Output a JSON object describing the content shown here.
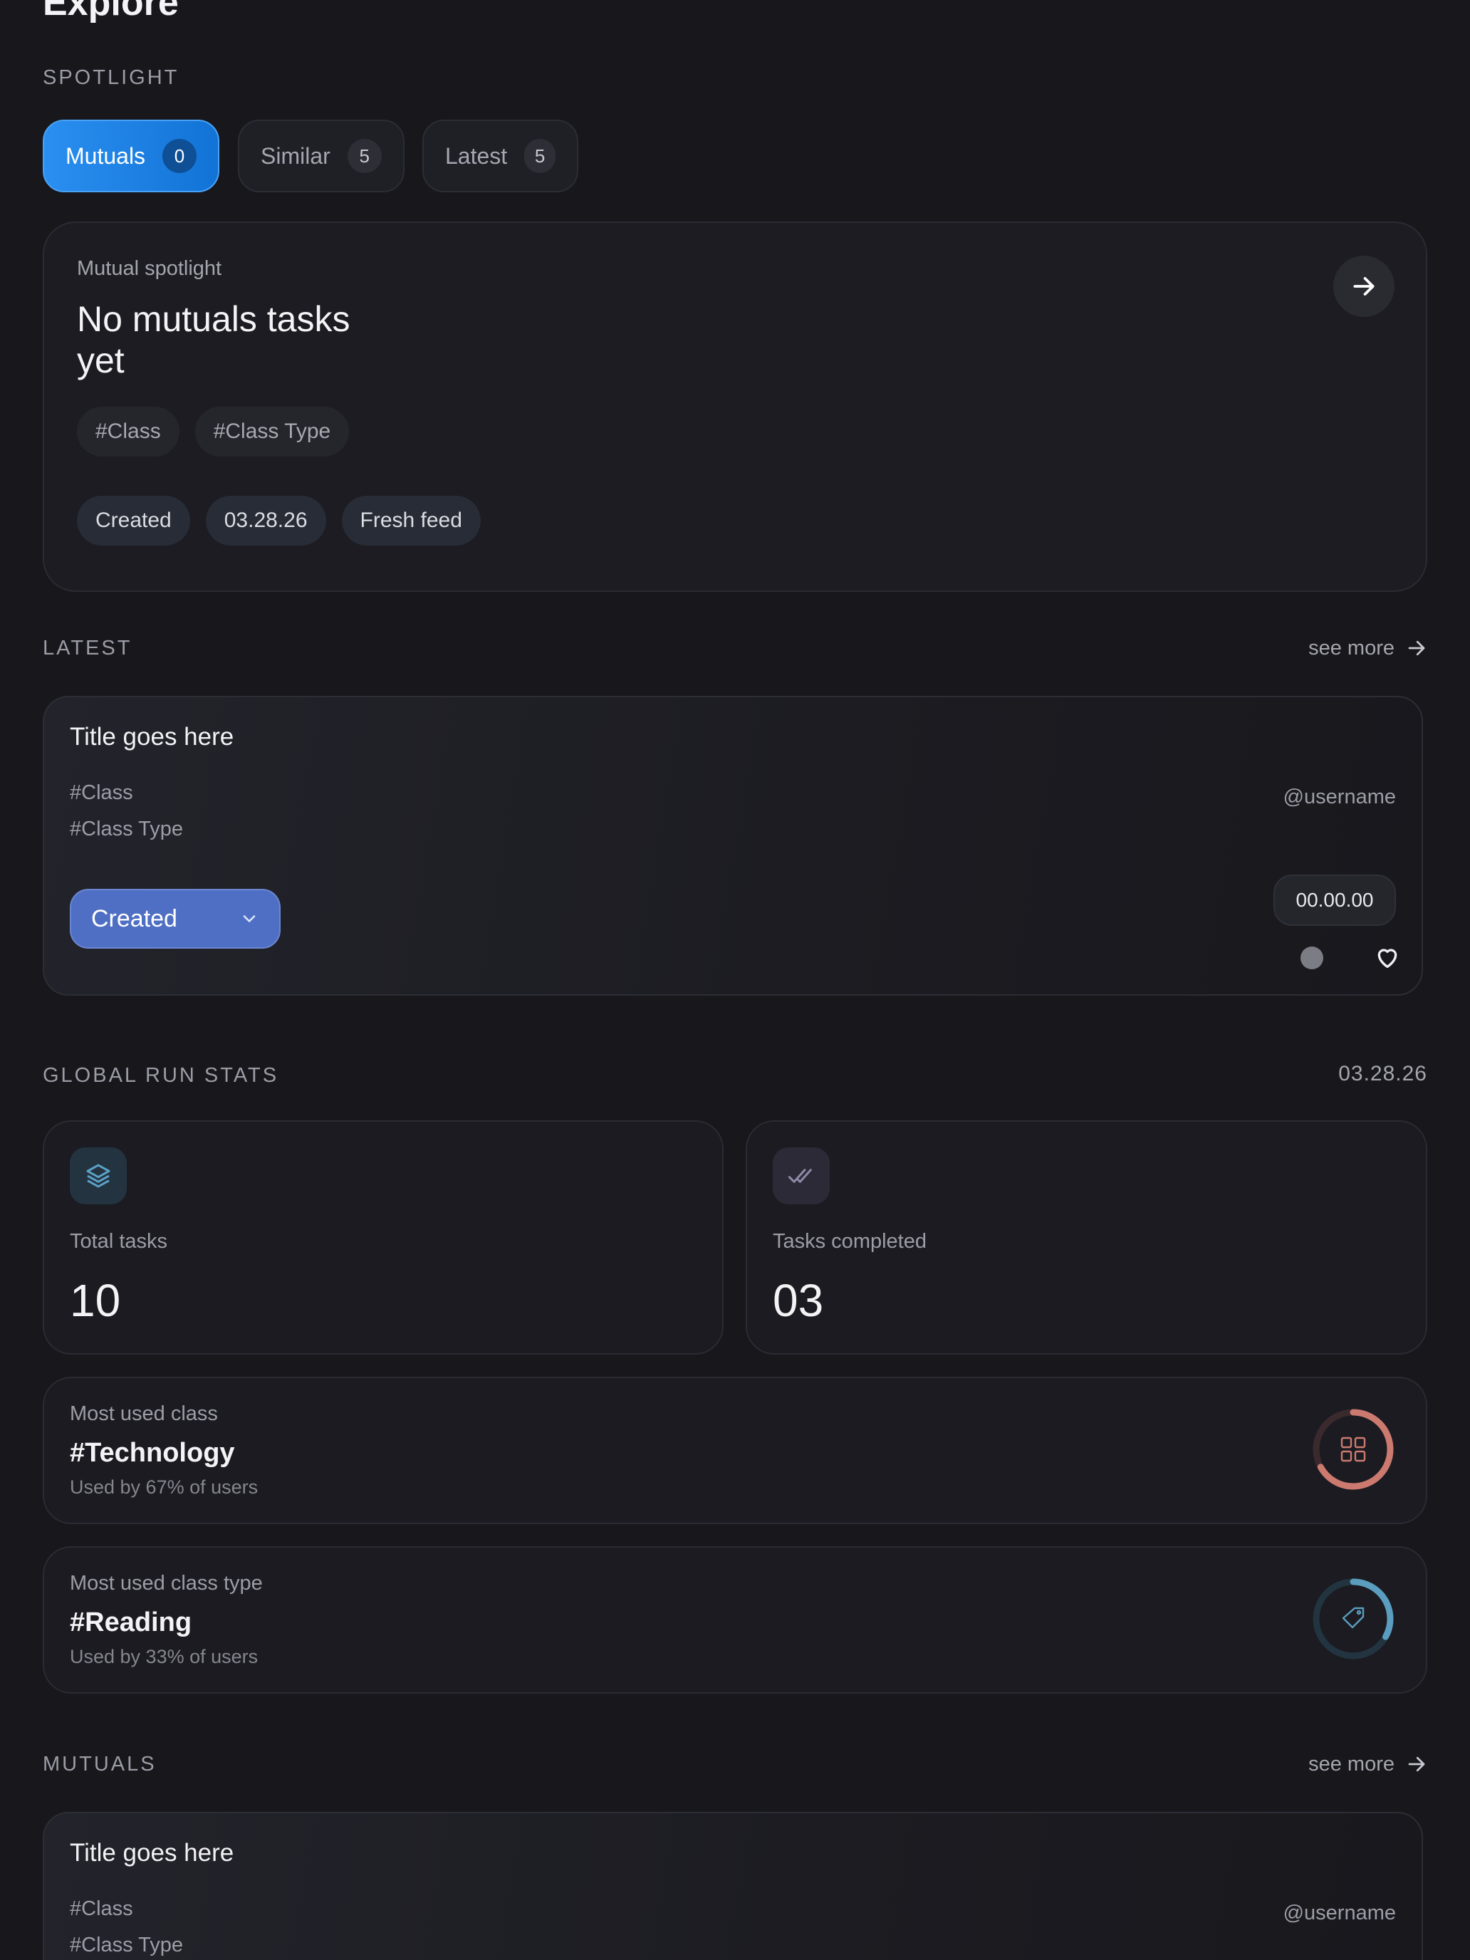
{
  "page": {
    "title": "Explore"
  },
  "spotlight": {
    "label": "SPOTLIGHT",
    "tabs": [
      {
        "label": "Mutuals",
        "count": "0",
        "active": true
      },
      {
        "label": "Similar",
        "count": "5",
        "active": false
      },
      {
        "label": "Latest",
        "count": "5",
        "active": false
      }
    ],
    "card": {
      "eyebrow": "Mutual spotlight",
      "title_line1": "No mutuals tasks",
      "title_line2": "yet",
      "tags": [
        "#Class",
        "#Class Type"
      ],
      "meta": [
        "Created",
        "03.28.26",
        "Fresh feed"
      ],
      "arrow_icon": "arrow-right-icon"
    }
  },
  "latest": {
    "label": "LATEST",
    "see_more": "see more",
    "card": {
      "title": "Title goes here",
      "class": "#Class",
      "class_type": "#Class Type",
      "username": "@username",
      "status_select": "Created",
      "date": "00.00.00"
    }
  },
  "stats": {
    "label": "GLOBAL RUN STATS",
    "date": "03.28.26",
    "total": {
      "label": "Total tasks",
      "value": "10",
      "icon": "layers-icon"
    },
    "completed": {
      "label": "Tasks completed",
      "value": "03",
      "icon": "double-check-icon"
    },
    "class": {
      "label": "Most used class",
      "value": "#Technology",
      "sub": "Used by 67% of users",
      "percent": 67,
      "icon": "grid-icon",
      "color": "#cc7a70"
    },
    "class_type": {
      "label": "Most used class type",
      "value": "#Reading",
      "sub": "Used by 33% of users",
      "percent": 33,
      "icon": "tag-icon",
      "color": "#5b9dbf"
    }
  },
  "mutuals": {
    "label": "MUTUALS",
    "see_more": "see more",
    "card": {
      "title": "Title goes here",
      "class": "#Class",
      "class_type": "#Class Type",
      "username": "@username"
    }
  },
  "colors": {
    "accent": "#1f84ea",
    "background": "#17171c",
    "select": "#4f6fc4"
  }
}
